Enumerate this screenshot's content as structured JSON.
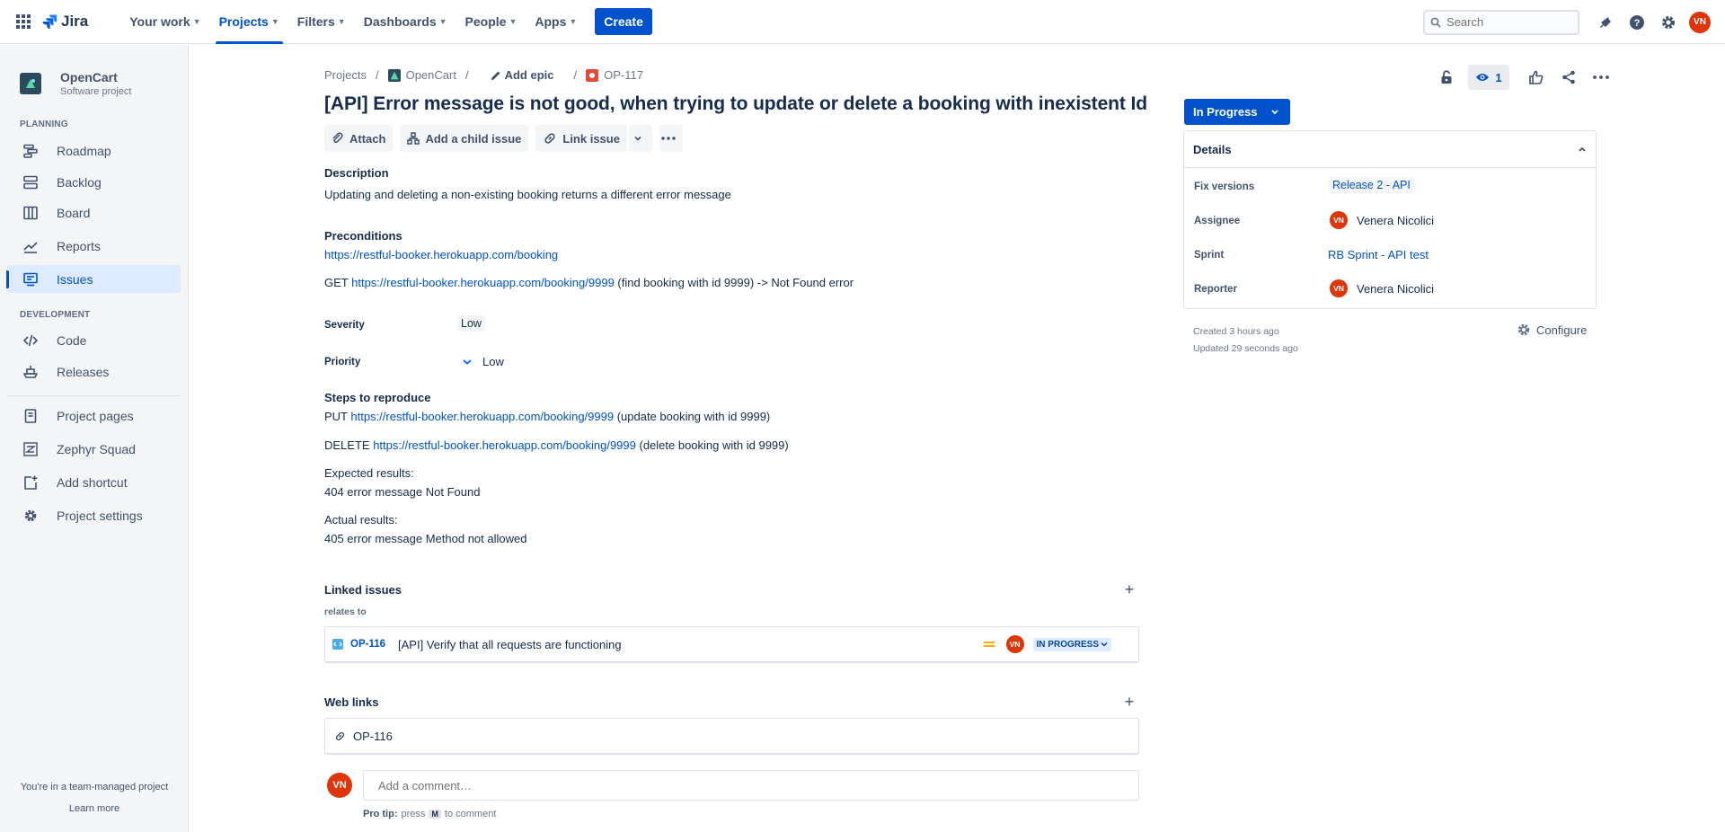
{
  "topnav": {
    "logo": "Jira",
    "items": [
      {
        "label": "Your work"
      },
      {
        "label": "Projects"
      },
      {
        "label": "Filters"
      },
      {
        "label": "Dashboards"
      },
      {
        "label": "People"
      },
      {
        "label": "Apps"
      }
    ],
    "create": "Create",
    "search_placeholder": "Search",
    "user_initials": "VN"
  },
  "sidebar": {
    "project_name": "OpenCart",
    "project_type": "Software project",
    "planning_label": "PLANNING",
    "development_label": "DEVELOPMENT",
    "planning": [
      "Roadmap",
      "Backlog",
      "Board",
      "Reports",
      "Issues"
    ],
    "development": [
      "Code",
      "Releases"
    ],
    "other": [
      "Project pages",
      "Zephyr Squad",
      "Add shortcut",
      "Project settings"
    ],
    "footer_text": "You're in a team-managed project",
    "footer_link": "Learn more"
  },
  "breadcrumb": {
    "projects": "Projects",
    "project": "OpenCart",
    "epic": "Add epic",
    "issue": "OP-117"
  },
  "issue": {
    "title": "[API] Error message is not good, when trying to update or delete a booking with inexistent Id",
    "actions": {
      "attach": "Attach",
      "child": "Add a child issue",
      "link": "Link issue"
    },
    "description_label": "Description",
    "description": "Updating and deleting a non-existing booking returns a different error message",
    "preconditions_label": "Preconditions",
    "precond_link": "https://restful-booker.herokuapp.com/booking",
    "get_prefix": "GET ",
    "get_link": "https://restful-booker.herokuapp.com/booking/9999",
    "get_suffix": " (find booking with id 9999) -> Not Found error",
    "severity_label": "Severity",
    "severity": "Low",
    "priority_label": "Priority",
    "priority": "Low",
    "steps_label": "Steps to reproduce",
    "put_prefix": "PUT ",
    "put_link": "https://restful-booker.herokuapp.com/booking/9999",
    "put_suffix": " (update booking with id 9999)",
    "delete_prefix": "DELETE ",
    "delete_link": "https://restful-booker.herokuapp.com/booking/9999",
    "delete_suffix": " (delete booking with id 9999)",
    "expected_label": "Expected results:",
    "expected": "404 error message Not Found",
    "actual_label": "Actual results:",
    "actual": "405 error message Method not allowed",
    "linked_label": "Linked issues",
    "relates_to": "relates to",
    "linked": {
      "key": "OP-116",
      "summary": "[API] Verify that all requests are functioning",
      "assignee": "VN",
      "status": "IN PROGRESS"
    },
    "weblinks_label": "Web links",
    "weblink": "OP-116",
    "comment_avatar": "VN",
    "comment_placeholder": "Add a comment…",
    "protip_bold": "Pro tip:",
    "protip_pre": "press",
    "protip_key": "M",
    "protip_post": "to comment"
  },
  "right": {
    "watch_count": "1",
    "status": "In Progress",
    "details_label": "Details",
    "fix_versions_label": "Fix versions",
    "fix_version": "Release 2 - API",
    "assignee_label": "Assignee",
    "assignee": "Venera Nicolici",
    "assignee_initials": "VN",
    "sprint_label": "Sprint",
    "sprint": "RB Sprint - API test",
    "reporter_label": "Reporter",
    "reporter": "Venera Nicolici",
    "reporter_initials": "VN",
    "created": "Created 3 hours ago",
    "updated": "Updated 29 seconds ago",
    "configure": "Configure"
  },
  "colors": {
    "brand": "#0052cc",
    "avatar": "#de350b",
    "sidebar_bg": "#f4f5f7"
  }
}
